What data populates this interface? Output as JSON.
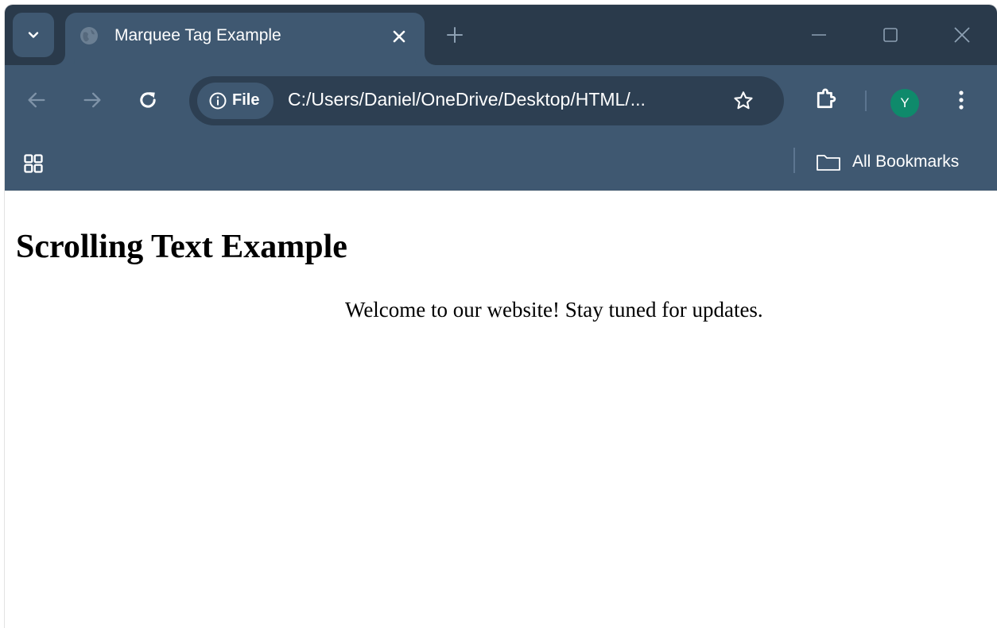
{
  "browser": {
    "tab": {
      "title": "Marquee Tag Example",
      "favicon": "globe-icon"
    },
    "address_bar": {
      "scheme_label": "File",
      "url": "C:/Users/Daniel/OneDrive/Desktop/HTML/..."
    },
    "profile": {
      "initial": "Y",
      "color": "#0f8a6b"
    },
    "bookmarks_bar": {
      "all_bookmarks_label": "All Bookmarks"
    },
    "colors": {
      "tabstrip": "#2a3a4b",
      "toolbar": "#3f5871",
      "omnibox": "#2d3f52"
    }
  },
  "page": {
    "heading": "Scrolling Text Example",
    "marquee_text": "Welcome to our website! Stay tuned for updates."
  }
}
